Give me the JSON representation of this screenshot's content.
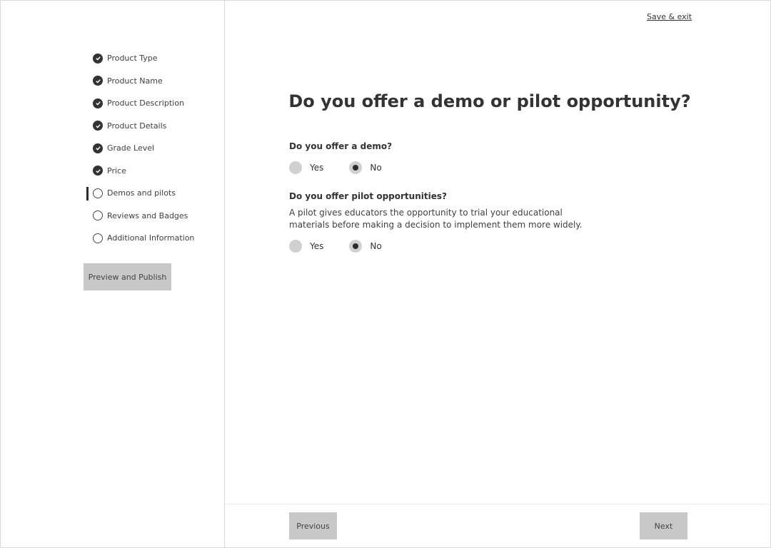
{
  "header": {
    "save_exit": "Save & exit"
  },
  "sidebar": {
    "steps": [
      {
        "label": "Product Type",
        "status": "complete"
      },
      {
        "label": "Product Name",
        "status": "complete"
      },
      {
        "label": "Product Description",
        "status": "complete"
      },
      {
        "label": "Product Details",
        "status": "complete"
      },
      {
        "label": "Grade Level",
        "status": "complete"
      },
      {
        "label": "Price",
        "status": "complete"
      },
      {
        "label": "Demos and pilots",
        "status": "current"
      },
      {
        "label": "Reviews and Badges",
        "status": "incomplete"
      },
      {
        "label": "Additional Information",
        "status": "incomplete"
      }
    ],
    "preview_button": "Preview and Publish"
  },
  "main": {
    "title": "Do you offer a demo or pilot opportunity?",
    "questions": [
      {
        "label": "Do you offer a demo?",
        "options": [
          {
            "label": "Yes",
            "selected": false
          },
          {
            "label": "No",
            "selected": true
          }
        ]
      },
      {
        "label": "Do you offer pilot opportunities?",
        "helper": "A pilot gives educators the opportunity to trial your educational materials before making a decision to implement them more widely.",
        "options": [
          {
            "label": "Yes",
            "selected": false
          },
          {
            "label": "No",
            "selected": true
          }
        ]
      }
    ]
  },
  "footer": {
    "previous": "Previous",
    "next": "Next"
  },
  "colors": {
    "button_bg": "#c8c8c8",
    "radio_bg": "#d0d0d0",
    "text": "#333333",
    "check_fill": "#333333"
  }
}
